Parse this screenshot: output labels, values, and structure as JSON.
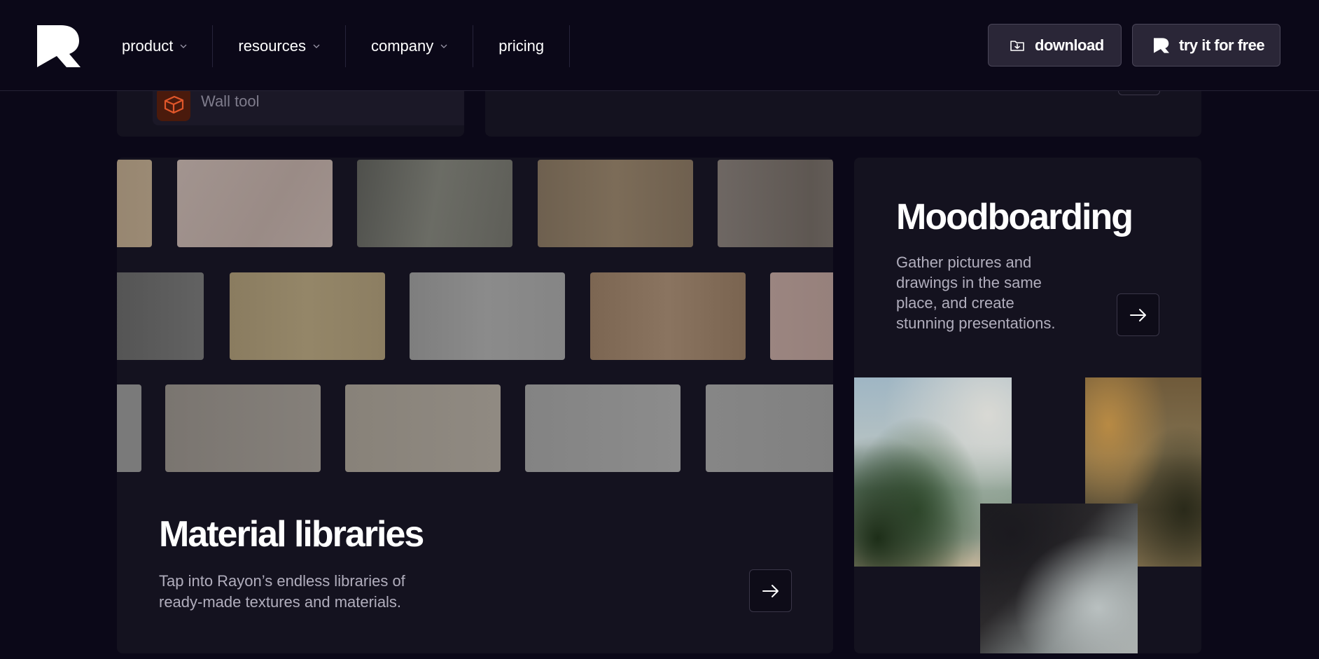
{
  "nav": {
    "links": [
      {
        "label": "product",
        "has_dropdown": true
      },
      {
        "label": "resources",
        "has_dropdown": true
      },
      {
        "label": "company",
        "has_dropdown": true
      },
      {
        "label": "pricing",
        "has_dropdown": false
      }
    ],
    "download_label": "download",
    "try_label": "try it for free"
  },
  "top_card": {
    "wall_tool_label": "Wall tool",
    "wall_tool_icon": "wall-brick-icon"
  },
  "material": {
    "title": "Material libraries",
    "description": "Tap into Rayon’s endless libraries of ready-made textures and materials.",
    "arrow_icon": "arrow-right-icon"
  },
  "mood": {
    "title": "Moodboarding",
    "description": "Gather pictures and drawings in the same place, and create stunning presentations.",
    "arrow_icon": "arrow-right-icon"
  },
  "colors": {
    "background": "#0b0818",
    "card": "#14121f",
    "accent_wall": "#e0562a",
    "muted_text": "#b1aebd"
  }
}
